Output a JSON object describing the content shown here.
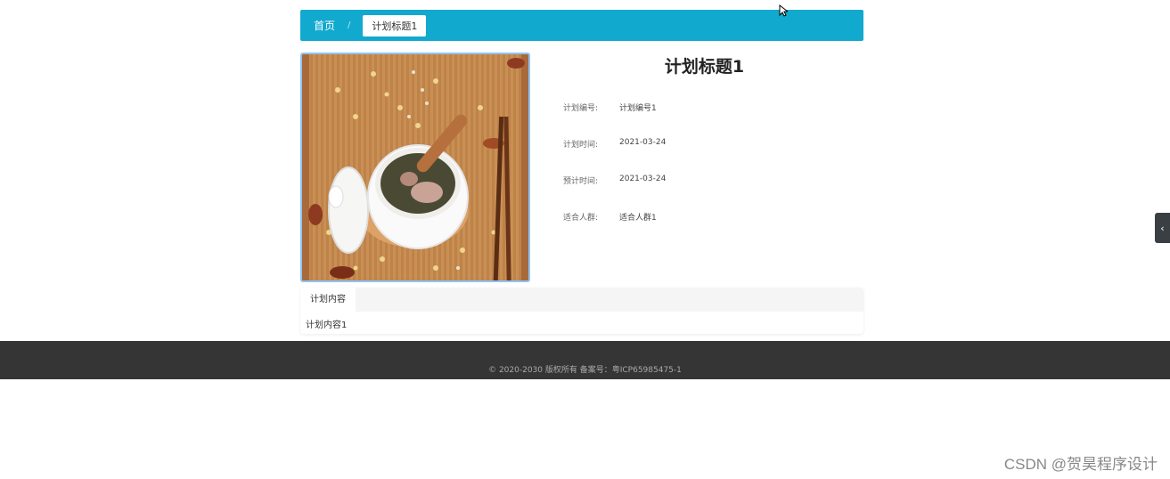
{
  "breadcrumb": {
    "home": "首页",
    "separator": "/",
    "current": "计划标题1"
  },
  "detail": {
    "title": "计划标题1",
    "fields": [
      {
        "label": "计划编号:",
        "value": "计划编号1"
      },
      {
        "label": "计划时间:",
        "value": "2021-03-24"
      },
      {
        "label": "预计时间:",
        "value": "2021-03-24"
      },
      {
        "label": "适合人群:",
        "value": "适合人群1"
      }
    ]
  },
  "tabs": {
    "active_label": "计划内容",
    "content": "计划内容1"
  },
  "footer": {
    "text": "© 2020-2030 版权所有 备案号：粤ICP65985475-1"
  },
  "watermark": "CSDN @贺昊程序设计",
  "colors": {
    "accent": "#12a9cf",
    "footer_bg": "#353535"
  }
}
